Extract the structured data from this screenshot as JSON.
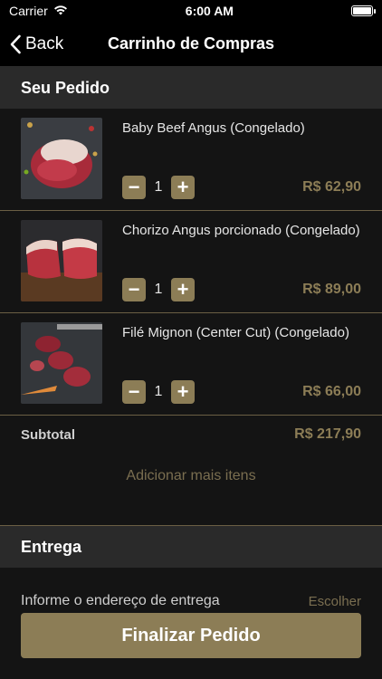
{
  "status": {
    "carrier": "Carrier",
    "time": "6:00 AM"
  },
  "nav": {
    "back_label": "Back",
    "title": "Carrinho de Compras"
  },
  "order": {
    "header": "Seu Pedido",
    "items": [
      {
        "name": "Baby Beef Angus (Congelado)",
        "quantity": "1",
        "price": "R$ 62,90"
      },
      {
        "name": "Chorizo Angus porcionado (Congelado)",
        "quantity": "1",
        "price": "R$ 89,00"
      },
      {
        "name": "Filé Mignon (Center Cut) (Congelado)",
        "quantity": "1",
        "price": "R$ 66,00"
      }
    ],
    "subtotal_label": "Subtotal",
    "subtotal_value": "R$ 217,90",
    "add_more": "Adicionar mais itens"
  },
  "delivery": {
    "header": "Entrega",
    "address_label": "Informe o endereço de entrega",
    "address_action": "Escolher"
  },
  "cta": {
    "label": "Finalizar Pedido"
  },
  "colors": {
    "accent": "#8c7d56",
    "background": "#141414",
    "section": "#2a2a2a"
  },
  "icons": [
    "wifi-icon",
    "battery-icon",
    "chevron-left-icon",
    "minus-icon",
    "plus-icon"
  ]
}
